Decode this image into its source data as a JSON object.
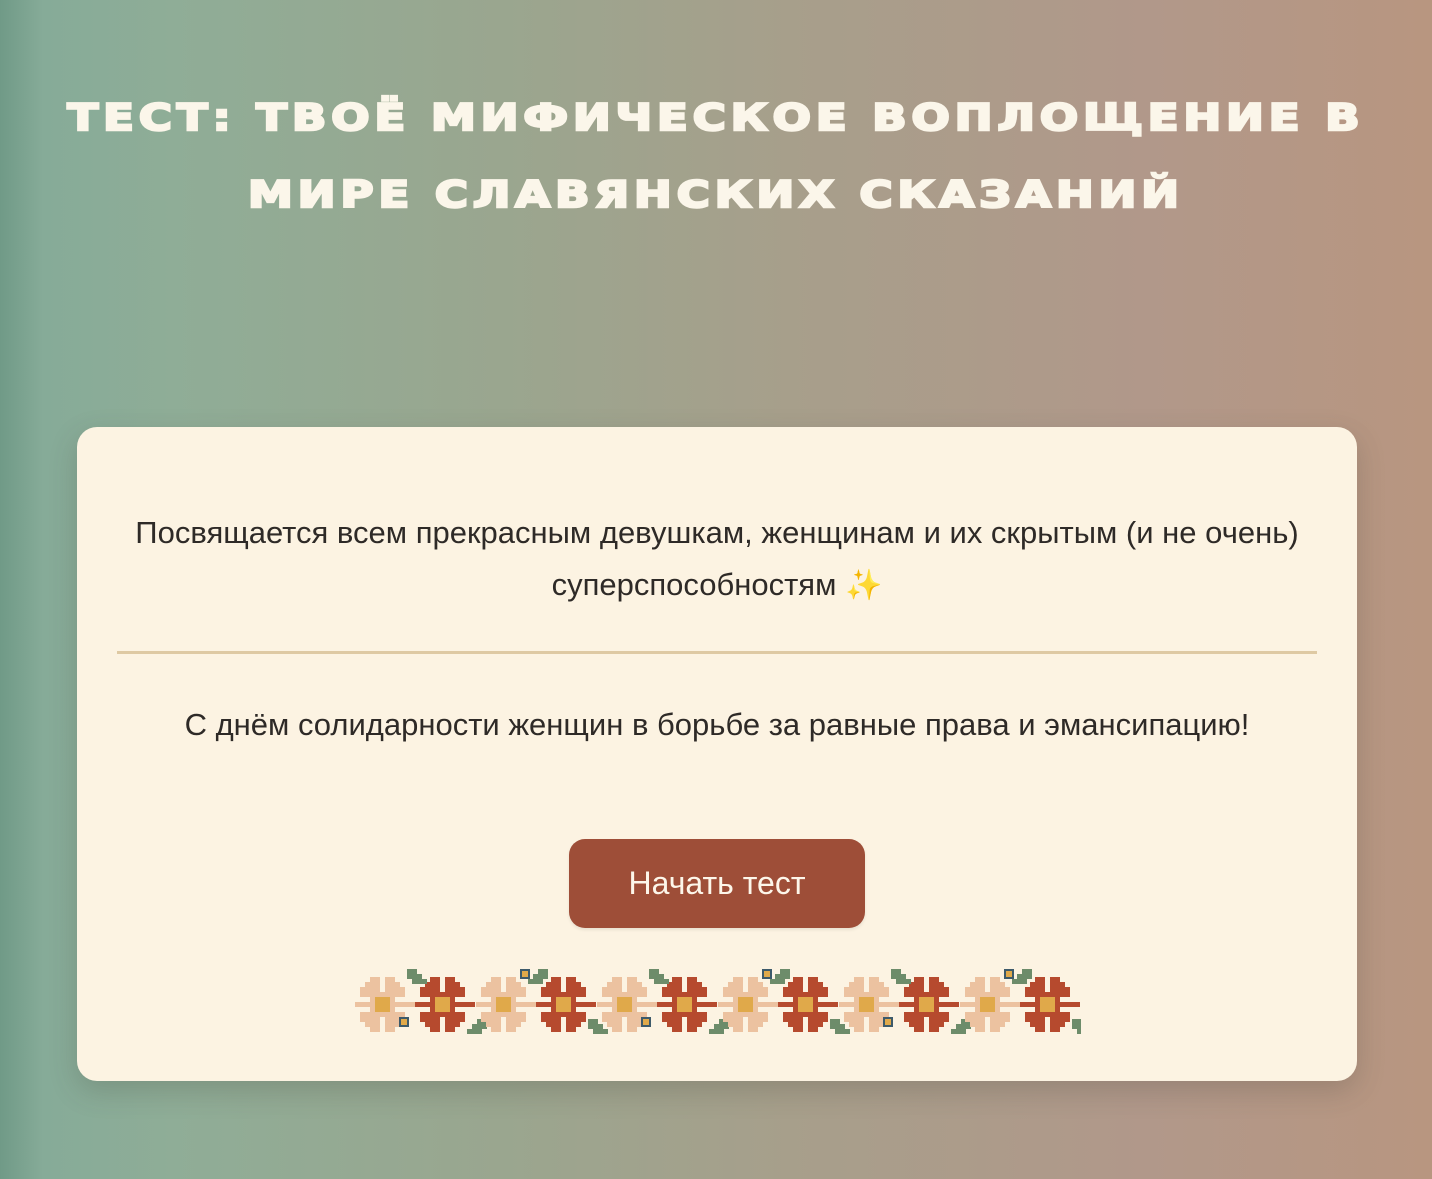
{
  "header": {
    "title": "Тест: твоё мифическое воплощение в мире славянских сказаний"
  },
  "intro_card": {
    "dedication": "Посвящается всем прекрасным девушкам, женщинам и их скрытым (и не очень) суперспособностям",
    "sparkles_icon": "sparkles-icon",
    "greeting": "С днём солидарности женщин в борьбе за равные права и эмансипацию!",
    "start_button_label": "Начать тест",
    "ornament_icon": "flower-ornament-icon"
  },
  "colors": {
    "background_gradient_start": "#8fad97",
    "background_gradient_end": "#b89680",
    "card_background": "#fcf3e2",
    "button": "#9e4e38",
    "divider": "#dec9a3",
    "flower_light": "#ecc2a0",
    "flower_dark": "#b64a2e",
    "flower_center": "#e0a94a",
    "leaf": "#6d8c6a"
  }
}
